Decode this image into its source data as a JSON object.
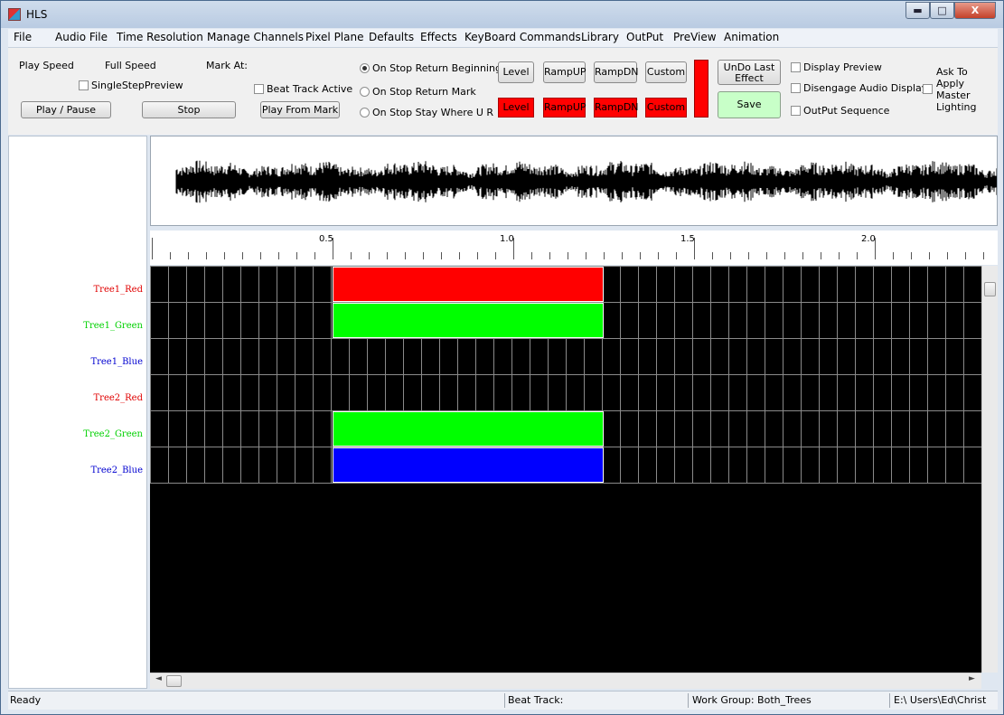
{
  "window": {
    "title": "HLS",
    "min_label": "▬",
    "max_label": "□",
    "close_label": "X"
  },
  "menu": [
    "File",
    "Audio File",
    "Time Resolution",
    "Manage Channels",
    "Pixel Plane",
    "Defaults",
    "Effects",
    "KeyBoard Commands",
    "Library",
    "OutPut",
    "PreView",
    "Animation"
  ],
  "toolbar": {
    "play_speed": "Play Speed",
    "full_speed": "Full Speed",
    "mark_at": "Mark At:",
    "single_step": "SingleStepPreview",
    "beat_track": "Beat Track Active",
    "play_pause": "Play / Pause",
    "stop": "Stop",
    "play_from_mark": "Play From Mark",
    "radio_beginning": "On Stop Return Beginning",
    "radio_mark": "On Stop Return Mark",
    "radio_stay": "On Stop Stay Where U R",
    "effect_buttons": [
      "Level",
      "RampUP",
      "RampDN",
      "Custom"
    ],
    "red_buttons": [
      "Level",
      "RampUP",
      "RampDN",
      "Custom"
    ],
    "undo_line1": "UnDo Last",
    "undo_line2": "Effect",
    "save": "Save",
    "display_preview": "Display Preview",
    "disengage_audio": "Disengage Audio Display",
    "output_sequence": "OutPut Sequence",
    "ask_to_apply": [
      "Ask To",
      "Apply",
      "Master",
      "Lighting"
    ],
    "current_color": "#ff0000"
  },
  "channels": [
    {
      "name": "Tree1_Red",
      "color": "#e00000"
    },
    {
      "name": "Tree1_Green",
      "color": "#00d000"
    },
    {
      "name": "Tree1_Blue",
      "color": "#0000d0"
    },
    {
      "name": "Tree2_Red",
      "color": "#e00000"
    },
    {
      "name": "Tree2_Green",
      "color": "#00d000"
    },
    {
      "name": "Tree2_Blue",
      "color": "#0000d0"
    }
  ],
  "ruler": {
    "labels": [
      "0.5",
      "1.0",
      "1.5",
      "2.0"
    ]
  },
  "effects": [
    {
      "channel": 0,
      "color": "#ff0000"
    },
    {
      "channel": 1,
      "color": "#00ff00"
    },
    {
      "channel": 4,
      "color": "#00ff00"
    },
    {
      "channel": 5,
      "color": "#0000ff"
    }
  ],
  "status": {
    "ready": "Ready",
    "beat_track": "Beat Track:",
    "work_group": "Work Group: Both_Trees",
    "path": "E:\\ Users\\Ed\\Christ"
  }
}
